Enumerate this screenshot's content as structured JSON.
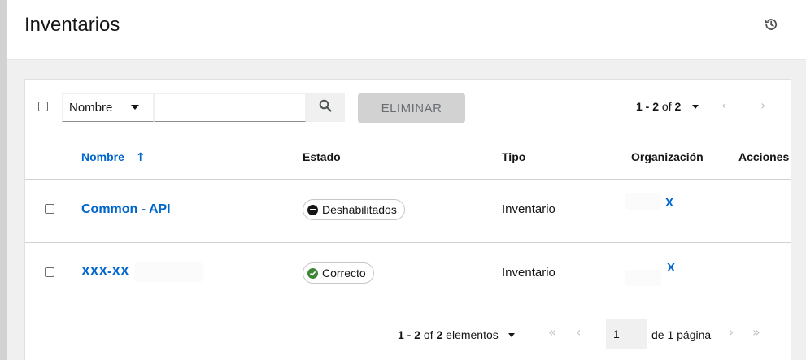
{
  "header": {
    "title": "Inventarios",
    "history_icon": "history-icon"
  },
  "toolbar": {
    "filter_label": "Nombre",
    "search_placeholder": "",
    "search_icon": "search-icon",
    "delete_label": "ELIMINAR",
    "pager": {
      "range": "1 - 2",
      "of_label": "of",
      "total": "2"
    }
  },
  "table": {
    "columns": [
      "Nombre",
      "Estado",
      "Tipo",
      "Organización",
      "Acciones"
    ],
    "sort_arrow": "↑",
    "rows": [
      {
        "name": "Common - API",
        "status": "Deshabilitados",
        "status_icon": "disabled-icon",
        "type": "Inventario",
        "organization": "X"
      },
      {
        "name": "XXX-XX",
        "status": "Correcto",
        "status_icon": "check-circle-icon",
        "type": "Inventario",
        "organization": "X"
      }
    ]
  },
  "footer": {
    "range": "1 - 2",
    "of_label": "of",
    "total": "2",
    "items_label": "elementos",
    "page_value": "1",
    "page_suffix": "de 1 página"
  },
  "colors": {
    "link": "#0066cc",
    "success": "#3e8635",
    "disabled_badge_icon": "#151515"
  }
}
